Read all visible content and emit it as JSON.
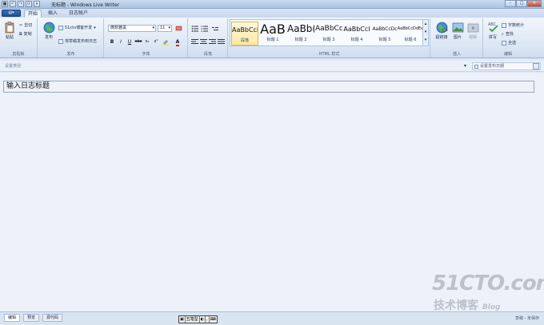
{
  "window": {
    "title": "无标题 - Windows Live Writer"
  },
  "tabs": [
    "开始",
    "插入",
    "日志帐户"
  ],
  "ribbon": {
    "clipboard": {
      "label": "剪贴板",
      "paste": "粘贴",
      "cut": "剪切",
      "copy": "复制"
    },
    "publish": {
      "label": "发布",
      "publish_btn": "发布",
      "blog_account": "51cto博客开发",
      "post_draft": "将草稿发布到日志"
    },
    "font": {
      "label": "字体",
      "font_name": "微软雅黑",
      "font_size": "11"
    },
    "paragraph": {
      "label": "段落"
    },
    "html_styles": {
      "label": "HTML 样式",
      "styles": [
        {
          "sample": "AaBbCcD",
          "name": "段落"
        },
        {
          "sample": "AaB",
          "name": "标题 1"
        },
        {
          "sample": "AaBb(",
          "name": "标题 2"
        },
        {
          "sample": "AaBbCc",
          "name": "标题 3"
        },
        {
          "sample": "AaBbCcI",
          "name": "标题 4"
        },
        {
          "sample": "AaBbCcDc",
          "name": "标题 5"
        },
        {
          "sample": "AaBbCcDdEe",
          "name": "标题 6"
        }
      ]
    },
    "insert": {
      "label": "插入",
      "hyperlink": "超链接",
      "picture": "图片",
      "video": "视频"
    },
    "edit": {
      "label": "编辑",
      "spell": "拼写",
      "word_count": "字数统计",
      "find": "查找",
      "select_all": "全选"
    }
  },
  "category": {
    "label": "设置类别",
    "pubdate": "设置发布日期"
  },
  "editor": {
    "title_placeholder": "输入日志标题"
  },
  "bottom": {
    "tabs": [
      "编辑",
      "预览",
      "源代码"
    ],
    "status": "草稿 - 未保存",
    "ime": [
      "五笔型"
    ]
  },
  "watermark": {
    "line1": "51CTO.com",
    "line2": "技术博客",
    "line3": "Blog"
  }
}
